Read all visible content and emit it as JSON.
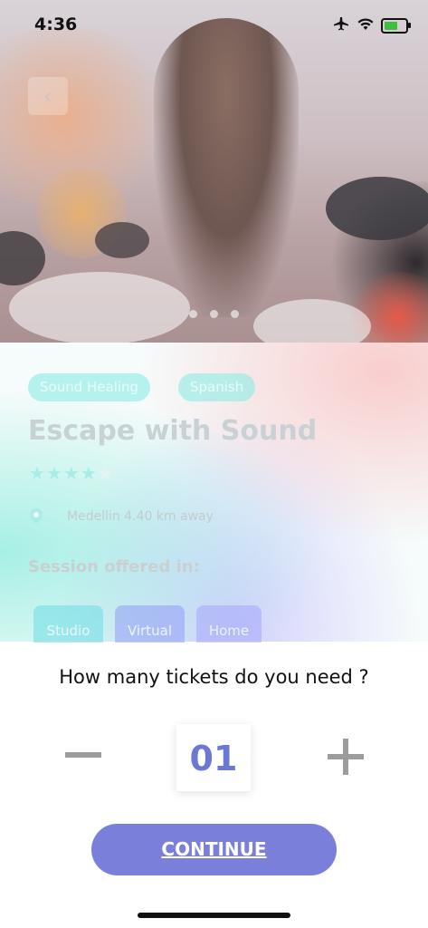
{
  "status_bar": {
    "time": "4:36"
  },
  "header": {
    "back_icon": "chevron-left-icon"
  },
  "carousel": {
    "pages": 3,
    "active_page": 1
  },
  "event": {
    "tags": [
      "Sound Healing",
      "Spanish"
    ],
    "title": "Escape with Sound",
    "rating": 4,
    "rating_max": 5,
    "location": "Medellin 4.40 km away",
    "session_heading": "Session offered in:",
    "session_options": [
      "Studio",
      "Virtual",
      "Home"
    ]
  },
  "ticket_dialog": {
    "question": "How many tickets do you need ?",
    "quantity": "01",
    "continue_label": "CONTINUE"
  },
  "colors": {
    "accent": "#7a7fd9",
    "quantity_text": "#6b78d6",
    "tag_bg": "#8cece4"
  }
}
